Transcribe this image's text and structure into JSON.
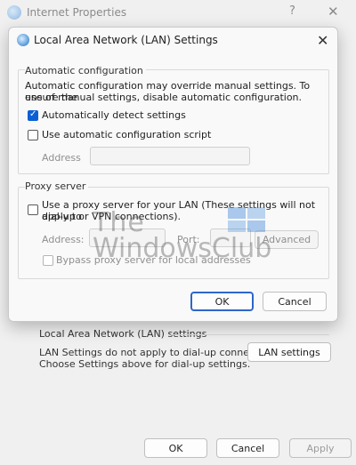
{
  "background_window": {
    "title": "Internet Properties",
    "help_glyph": "?",
    "close_glyph": "✕",
    "lan_group_title": "Local Area Network (LAN) settings",
    "lan_text_line1": "LAN Settings do not apply to dial-up connections.",
    "lan_text_line2": "Choose Settings above for dial-up settings.",
    "lan_settings_button": "LAN settings",
    "ok_button": "OK",
    "cancel_button": "Cancel",
    "apply_button": "Apply"
  },
  "dialog": {
    "title": "Local Area Network (LAN) Settings",
    "close_glyph": "✕",
    "automatic_configuration": {
      "group_title": "Automatic configuration",
      "description_line1": "Automatic configuration may override manual settings.  To ensure the",
      "description_line2": "use of manual settings, disable automatic configuration.",
      "auto_detect_label": "Automatically detect settings",
      "auto_detect_checked": true,
      "use_script_label": "Use automatic configuration script",
      "use_script_checked": false,
      "address_label": "Address",
      "address_value": ""
    },
    "proxy_server": {
      "group_title": "Proxy server",
      "use_proxy_label_line1": "Use a proxy server for your LAN (These settings will not apply to",
      "use_proxy_label_line2": "dial-up or VPN connections).",
      "use_proxy_checked": false,
      "address_label": "Address:",
      "address_value": "",
      "port_label": "Port:",
      "port_value": "",
      "advanced_button": "Advanced",
      "bypass_label": "Bypass proxy server for local addresses",
      "bypass_checked": false
    },
    "ok_button": "OK",
    "cancel_button": "Cancel"
  },
  "watermark": {
    "line1": "The",
    "line2": "WindowsClub"
  },
  "colors": {
    "accent": "#0a5fd6",
    "default_button_border": "#2e66c9",
    "dialog_background": "#f9f9f9",
    "window_background": "#f0f0f0"
  },
  "icons": {
    "window_icon": "internet-globe-icon",
    "dialog_icon": "internet-globe-icon",
    "watermark_logo": "windowsclub-logo"
  }
}
